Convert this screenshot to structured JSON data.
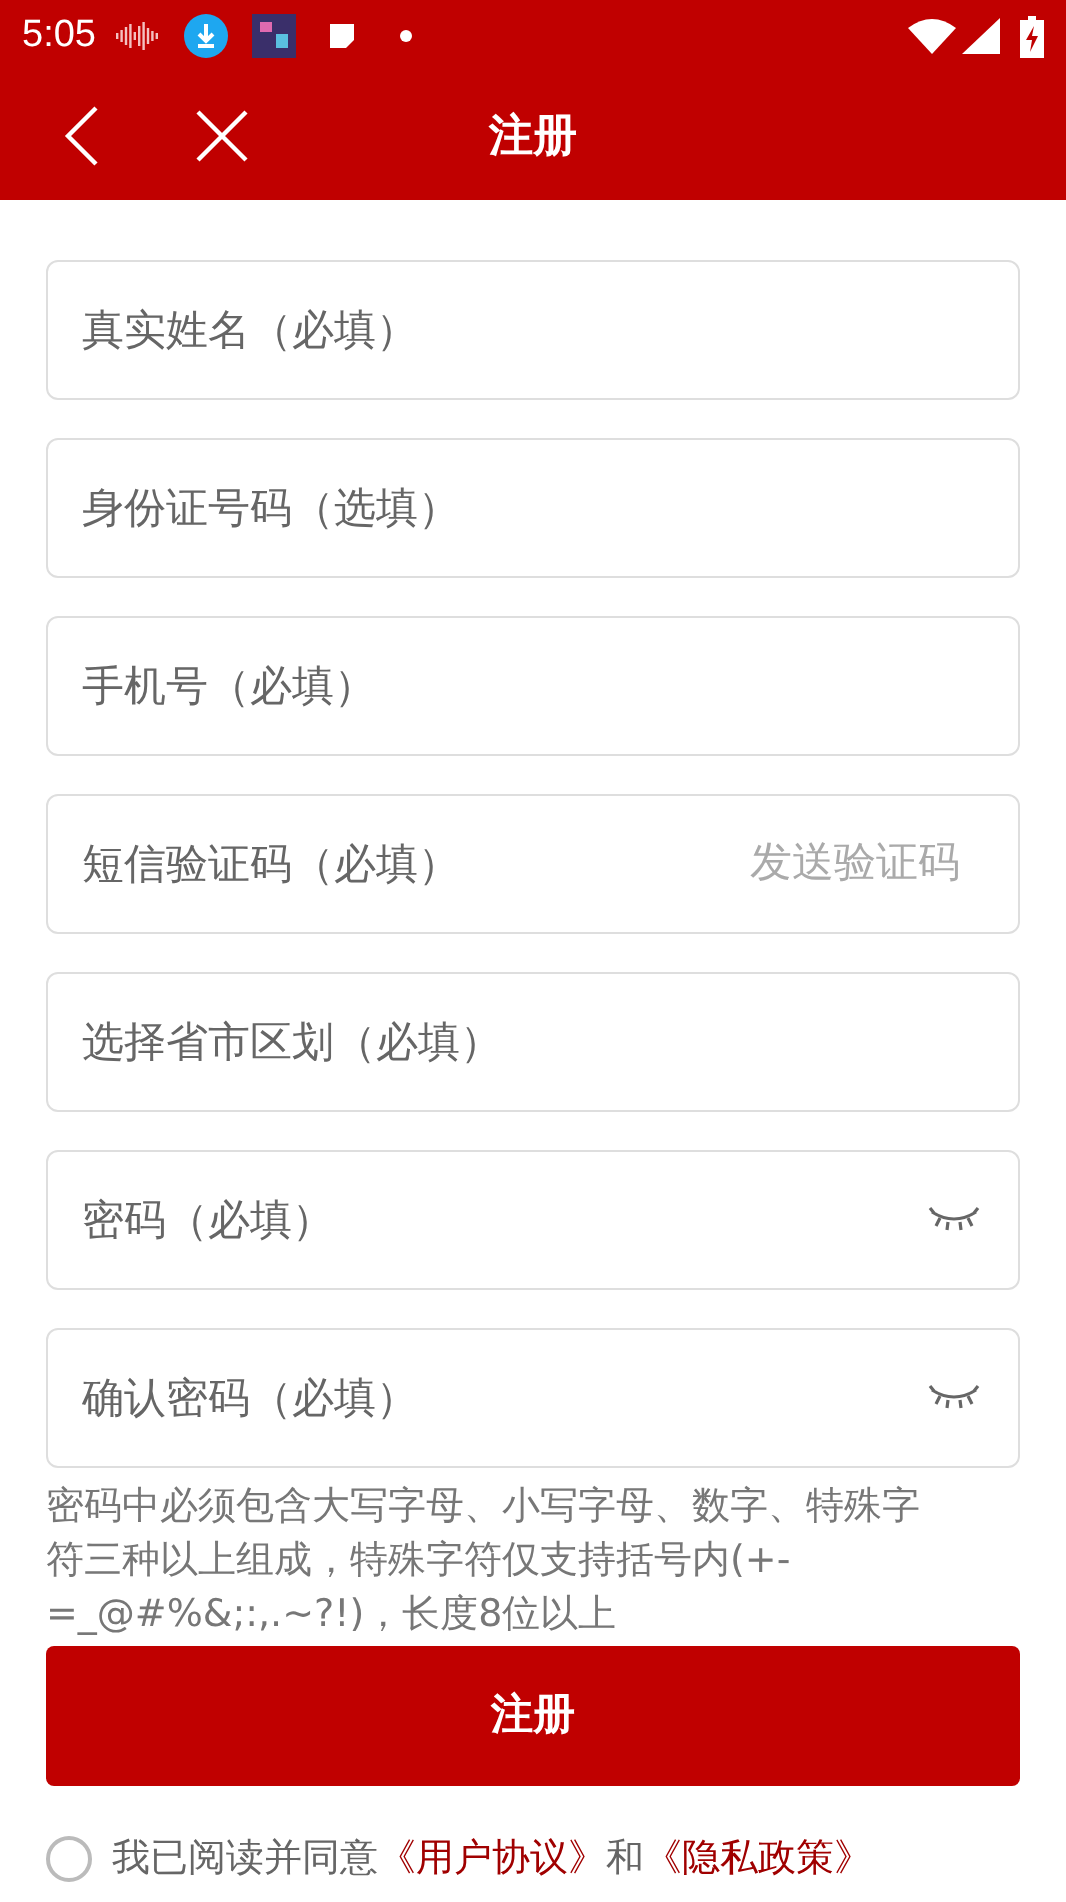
{
  "status_bar": {
    "time": "5:05"
  },
  "header": {
    "title": "注册"
  },
  "fields": [
    {
      "kind": "text",
      "placeholder": "真实姓名（必填）"
    },
    {
      "kind": "text",
      "placeholder": "身份证号码（选填）"
    },
    {
      "kind": "text",
      "placeholder": "手机号（必填）"
    },
    {
      "kind": "code",
      "placeholder": "短信验证码（必填）",
      "action": "发送验证码"
    },
    {
      "kind": "text",
      "placeholder": "选择省市区划（必填）"
    },
    {
      "kind": "password",
      "placeholder": "密码（必填）"
    },
    {
      "kind": "password",
      "placeholder": "确认密码（必填）"
    }
  ],
  "password_hint": "密码中必须包含大写字母、小写字母、数字、特殊字符三种以上组成，特殊字符仅支持括号内(+-=_@#%&;:,.~?!)，长度8位以上",
  "submit_button": "注册",
  "agreement": {
    "checked": false,
    "text": "我已阅读并同意",
    "user_agreement_link": "《用户协议》",
    "and": "和",
    "privacy_link": "《隐私政策》"
  }
}
